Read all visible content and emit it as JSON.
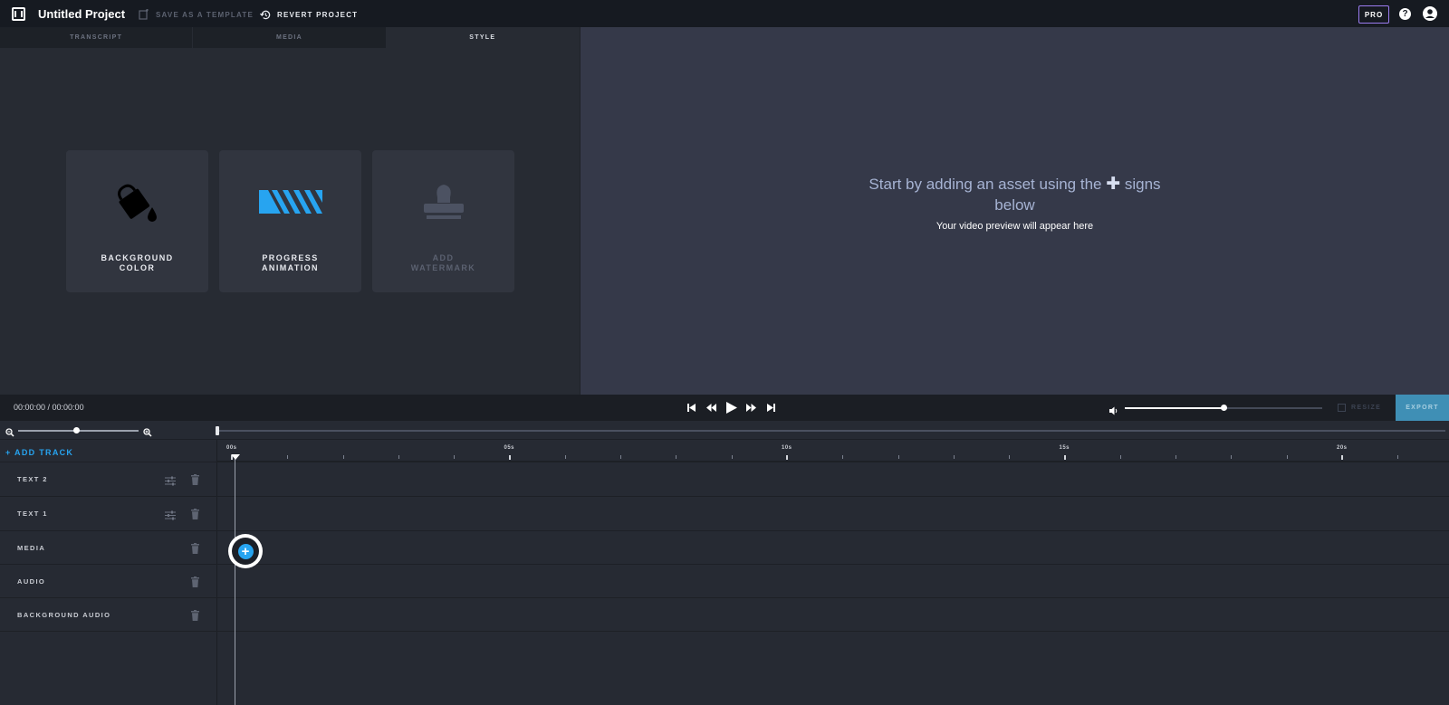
{
  "header": {
    "project_title": "Untitled Project",
    "save_template": "SAVE AS A TEMPLATE",
    "revert_project": "REVERT PROJECT",
    "pro_badge": "PRO",
    "help_glyph": "?"
  },
  "left_panel": {
    "tabs": [
      {
        "label": "TRANSCRIPT",
        "active": false
      },
      {
        "label": "MEDIA",
        "active": false
      },
      {
        "label": "STYLE",
        "active": true
      }
    ],
    "cards": [
      {
        "label": "BACKGROUND\nCOLOR",
        "icon": "paint-bucket-icon",
        "enabled": true
      },
      {
        "label": "PROGRESS\nANIMATION",
        "icon": "progress-bar-icon",
        "enabled": true
      },
      {
        "label": "ADD\nWATERMARK",
        "icon": "stamp-icon",
        "enabled": false
      }
    ]
  },
  "preview": {
    "line1_before": "Start by adding an asset using the",
    "line1_plus": "✚",
    "line1_after": "signs",
    "line2": "below",
    "subtitle": "Your video preview will appear here"
  },
  "playback": {
    "timecode": "00:00:00 / 00:00:00",
    "volume_level": 0.5,
    "resize_label": "RESIZE",
    "export_label": "EXPORT"
  },
  "zoom": {
    "level": 0.48,
    "scroll_position": 0
  },
  "timeline": {
    "add_track_label": "+ ADD TRACK",
    "tracks": [
      {
        "name": "TEXT 2",
        "has_settings": true
      },
      {
        "name": "TEXT 1",
        "has_settings": true
      },
      {
        "name": "MEDIA",
        "has_settings": false
      },
      {
        "name": "AUDIO",
        "has_settings": false
      },
      {
        "name": "BACKGROUND AUDIO",
        "has_settings": false
      }
    ],
    "ruler_labels": [
      "00s",
      "05s",
      "10s",
      "15s",
      "20s"
    ],
    "add_media_glyph": "+"
  },
  "colors": {
    "accent": "#27a4f0",
    "pro_border": "#9b7cf0",
    "export_bg": "#3f8fb5",
    "preview_bg": "#353949"
  }
}
